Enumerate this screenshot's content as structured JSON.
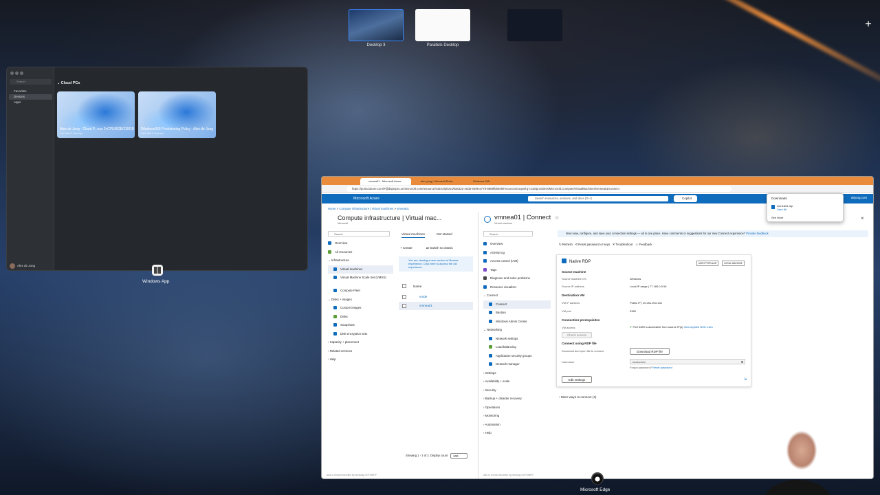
{
  "mission_control": {
    "desktops": [
      {
        "label": "Desktop 3",
        "selected": true
      },
      {
        "label": "Parallels Desktop",
        "selected": false
      },
      {
        "label": "",
        "selected": false
      }
    ],
    "add_desktop": "+"
  },
  "windows_app": {
    "section": "Cloud PCs",
    "sidebar": [
      "Favorites",
      "Devices",
      "Apps"
    ],
    "search_placeholder": "Search",
    "user": "Alex de Jong",
    "cloud_pcs": [
      {
        "name": "Alex de Jong - Cloud P...ess 2vCPU/8GB/128GB",
        "sub": "Last used 5 days ago"
      },
      {
        "name": "Windows365 Provisioning Policy - Alex de Jong",
        "sub": "Last used 2 days ago"
      }
    ],
    "dock_label": "Windows App"
  },
  "edge": {
    "tabs": [
      "vmnea01 - Microsoft Azure",
      "alex-jong | Microsoft Entra",
      "Windows 365"
    ],
    "url": "https://portal.azure.com/#@dajonpro.onmicrosoft.com/resource/subscriptions/0a6322-40da-4099-a778-8889f08309/resourceGroups/rg-cs16/providers/Microsoft.Compute/virtualMachines/vmnea01/connect",
    "dock_label": "Microsoft Edge"
  },
  "azure": {
    "brand": "Microsoft Azure",
    "search_placeholder": "Search resources, services, and docs (G+/)",
    "copilot": "Copilot",
    "breadcrumb": [
      "Home",
      "Compute infrastructure | Virtual machines",
      "vmnea01"
    ],
    "left": {
      "title": "Compute infrastructure | Virtual mac...",
      "subtitle": "Microsoft",
      "search": "Search",
      "nav": [
        "Overview",
        "All resources",
        "Infrastructure",
        "Virtual machines",
        "Virtual Machine Scale Set (VMSS)",
        "Compute Fleet",
        "Disks + images",
        "Custom images",
        "Disks",
        "Snapshots",
        "Disk encryption sets",
        "Capacity + placement",
        "Related services",
        "Help"
      ],
      "tabs": [
        "Virtual machines",
        "Get started"
      ],
      "toolbar": [
        "Create",
        "Switch to classic"
      ],
      "info": "You are viewing a new version of Browse experience. Click here to access the old experience.",
      "col_name": "Name",
      "rows": [
        "vmde",
        "vmnea01"
      ],
      "footer": "Showing 1 - 2 of 2. Display count",
      "page_size": "100"
    },
    "mid": {
      "title": "vmnea01 | Connect",
      "subtitle": "Virtual machine",
      "search": "Search",
      "nav": [
        "Overview",
        "Activity log",
        "Access control (IAM)",
        "Tags",
        "Diagnose and solve problems",
        "Resource visualizer",
        "Connect",
        "Connect",
        "Bastion",
        "Windows Admin Center",
        "Networking",
        "Network settings",
        "Load balancing",
        "Application security groups",
        "Network manager",
        "Settings",
        "Availability + scale",
        "Security",
        "Backup + disaster recovery",
        "Operations",
        "Monitoring",
        "Automation",
        "Help"
      ]
    },
    "connect": {
      "banner": "Now view, configure, and save your connection settings — all in one place. Have comments or suggestions for our new Connect experience?",
      "banner_link": "Provide feedback",
      "actions": [
        "Refresh",
        "Reset password or keys",
        "Troubleshoot",
        "Feedback"
      ],
      "card_title": "Native RDP",
      "badges": [
        "MOST POPULAR",
        "LOCAL MACHINE"
      ],
      "source_h": "Source machine",
      "src_os_label": "Source machine OS",
      "src_os": "Windows",
      "src_ip_label": "Source IP address",
      "src_ip": "Local IP range | 77.165.0.0/16",
      "dest_h": "Destination VM",
      "vm_ip_label": "VM IP address",
      "vm_ip": "Public IP | 20.251.203.134",
      "vm_port_label": "VM port",
      "vm_port": "3389",
      "prereq_h": "Connection prerequisites",
      "vm_access_label": "VM access",
      "vm_access": "Port 3389 is accessible from source IP(s)",
      "vm_access_link": "View applied NSG rules",
      "check_access": "Check access",
      "rdp_h": "Connect using RDP file",
      "download_label": "Download and open file to connect",
      "download_btn": "Download RDP file",
      "username_label": "Username",
      "username": "localadmin",
      "forgot": "Forgot password?",
      "reset": "Reset password",
      "edit": "Edit settings",
      "more": "More ways to connect (4)",
      "footer_left": "Add or remove favorites by pressing Ctrl+Shift+F",
      "footer_mid": "Add or remove favorites by pressing Ctrl+Shift+F"
    },
    "downloads": {
      "title": "Downloads",
      "file": "vmnea01.rdp",
      "action": "Open file",
      "see_more": "See More"
    },
    "account": "dejong.com"
  },
  "colors": {
    "azure_blue": "#0f6cbd",
    "edge_tab": "#e98b3a",
    "success": "#107c10"
  }
}
